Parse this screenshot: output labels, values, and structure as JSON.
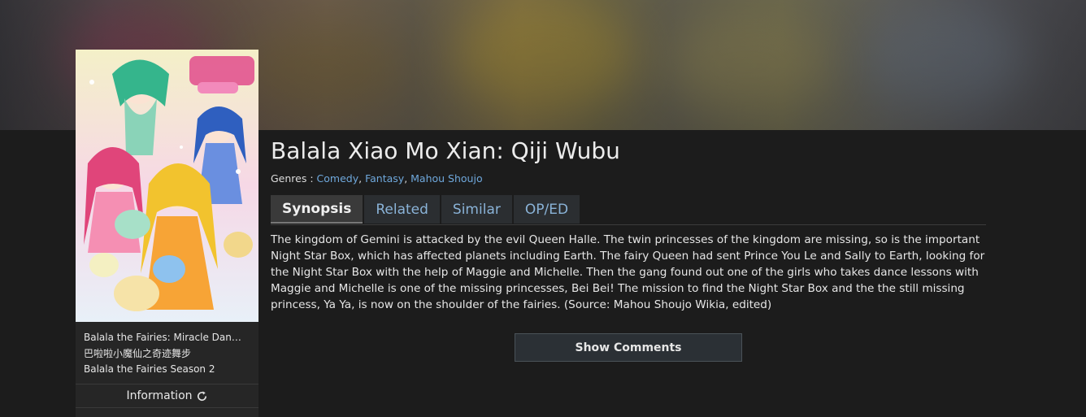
{
  "anime": {
    "title": "Balala Xiao Mo Xian: Qiji Wubu",
    "genres_label": "Genres :",
    "genres": [
      "Comedy",
      "Fantasy",
      "Mahou Shoujo"
    ],
    "alt_titles": [
      "Balala the Fairies: Miracle Dan…",
      "巴啦啦小魔仙之奇迹舞步",
      "Balala the Fairies Season 2"
    ],
    "synopsis": "The kingdom of Gemini is attacked by the evil Queen Halle. The twin princesses of the kingdom are missing, so is the important Night Star Box, which has affected planets including Earth. The fairy Queen had sent Prince You Le and Sally to Earth, looking for the Night Star Box with the help of Maggie and Michelle. Then the gang found out one of the girls who takes dance lessons with Maggie and Michelle is one of the missing princesses, Bei Bei! The mission to find the Night Star Box and the the still missing princess, Ya Ya, is now on the shoulder of the fairies. (Source: Mahou Shoujo Wikia, edited)"
  },
  "tabs": [
    {
      "label": "Synopsis",
      "active": true
    },
    {
      "label": "Related",
      "active": false
    },
    {
      "label": "Similar",
      "active": false
    },
    {
      "label": "OP/ED",
      "active": false
    }
  ],
  "sidebar": {
    "information_label": "Information",
    "information_icon": "refresh-icon"
  },
  "actions": {
    "show_comments": "Show Comments"
  },
  "colors": {
    "link": "#6fa8dc",
    "background": "#1c1c1c",
    "panel": "#262626"
  }
}
